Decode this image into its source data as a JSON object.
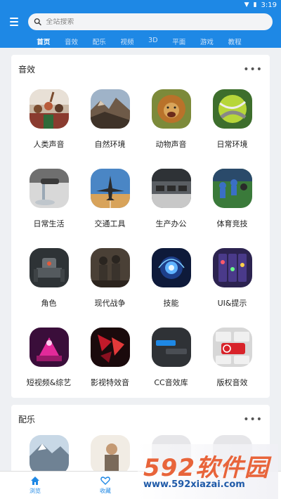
{
  "status": {
    "time": "3:19"
  },
  "search": {
    "placeholder": "全站搜索"
  },
  "tabs": [
    {
      "label": "首页",
      "active": true
    },
    {
      "label": "音效"
    },
    {
      "label": "配乐"
    },
    {
      "label": "视频"
    },
    {
      "label": "3D"
    },
    {
      "label": "平面"
    },
    {
      "label": "游戏"
    },
    {
      "label": "教程"
    }
  ],
  "sections": [
    {
      "title": "音效",
      "items": [
        {
          "label": "人类声音",
          "icon": "crowd-photo"
        },
        {
          "label": "自然环境",
          "icon": "mountain-photo"
        },
        {
          "label": "动物声音",
          "icon": "lion-photo"
        },
        {
          "label": "日常环境",
          "icon": "tennis-ball-photo"
        },
        {
          "label": "日常生活",
          "icon": "faucet-photo"
        },
        {
          "label": "交通工具",
          "icon": "airplane-photo"
        },
        {
          "label": "生产办公",
          "icon": "office-photo"
        },
        {
          "label": "体育竞技",
          "icon": "sports-photo"
        },
        {
          "label": "角色",
          "icon": "robot-photo"
        },
        {
          "label": "现代战争",
          "icon": "soldiers-photo"
        },
        {
          "label": "技能",
          "icon": "energy-orb-photo"
        },
        {
          "label": "UI&提示",
          "icon": "game-ui-photo"
        },
        {
          "label": "短视频&综艺",
          "icon": "pink-stage-photo"
        },
        {
          "label": "影视特效音",
          "icon": "red-shards-photo"
        },
        {
          "label": "CC音效库",
          "icon": "chat-ui-photo"
        },
        {
          "label": "版权音效",
          "icon": "copyright-key-photo"
        }
      ]
    },
    {
      "title": "配乐",
      "items": [
        {
          "icon": "snow-mountain-photo"
        },
        {
          "icon": "person-photo"
        },
        {
          "icon": "gray-photo"
        },
        {
          "icon": "gray-photo-2"
        }
      ]
    }
  ],
  "bottom_nav": [
    {
      "label": "浏览",
      "icon": "home-icon"
    },
    {
      "label": "收藏",
      "icon": "heart-icon"
    }
  ],
  "watermark": {
    "brand": "592软件园",
    "url": "www.592xiazai.com"
  },
  "colors": {
    "primary": "#1e88e5",
    "watermark_orange": "#e8643a",
    "watermark_blue": "#1f5aa8"
  }
}
